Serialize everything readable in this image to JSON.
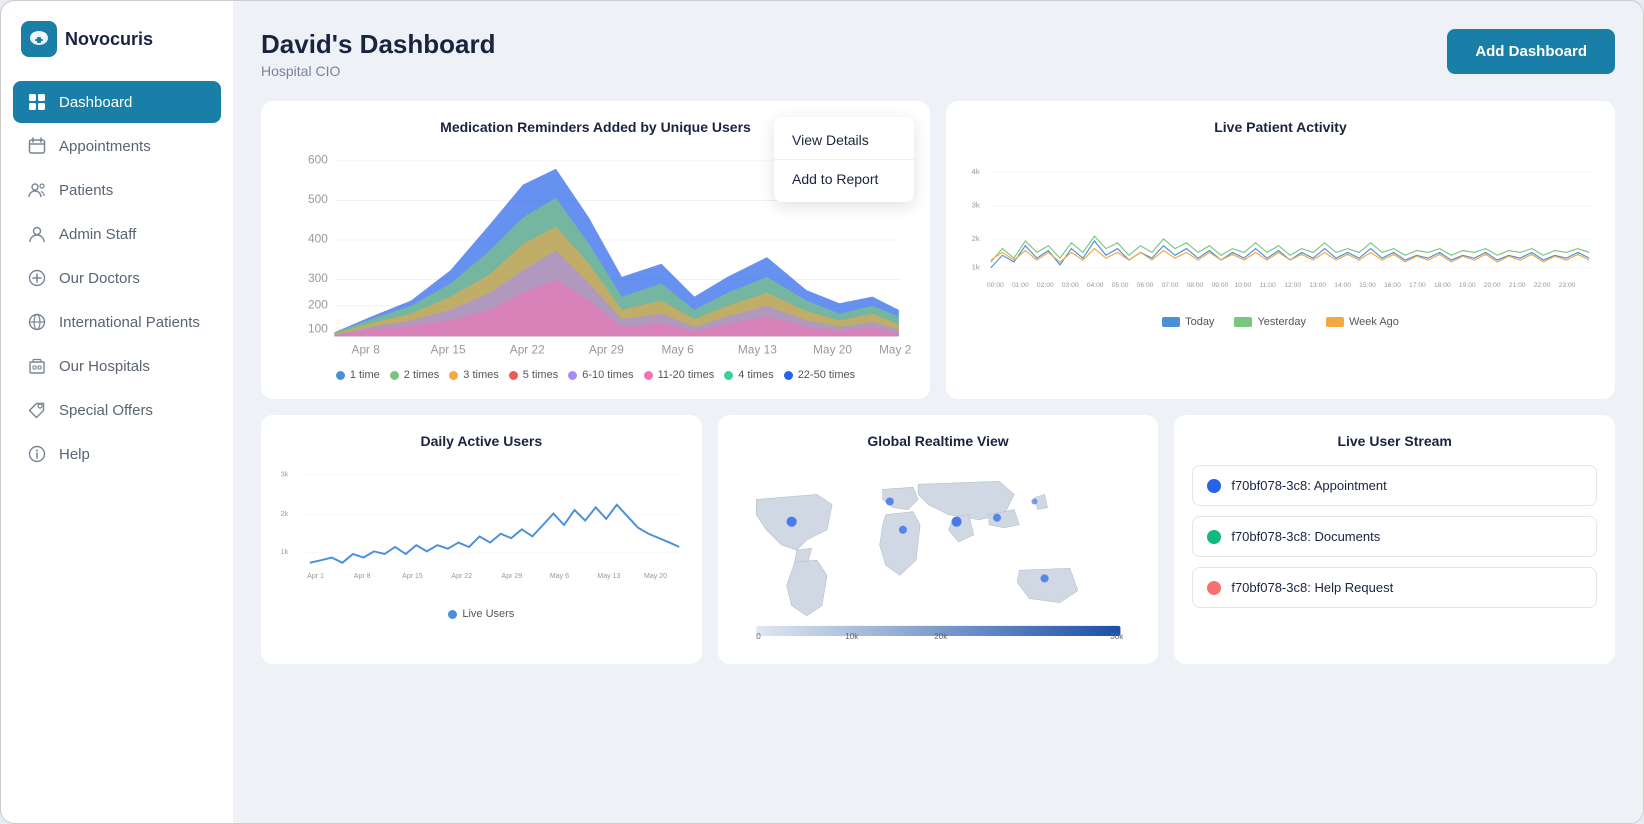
{
  "app": {
    "logo_text": "Novocuris"
  },
  "sidebar": {
    "items": [
      {
        "label": "Dashboard",
        "icon": "grid-icon",
        "active": true
      },
      {
        "label": "Appointments",
        "icon": "calendar-icon",
        "active": false
      },
      {
        "label": "Patients",
        "icon": "users-icon",
        "active": false
      },
      {
        "label": "Admin Staff",
        "icon": "person-icon",
        "active": false
      },
      {
        "label": "Our Doctors",
        "icon": "plus-circle-icon",
        "active": false
      },
      {
        "label": "International Patients",
        "icon": "globe-icon",
        "active": false
      },
      {
        "label": "Our Hospitals",
        "icon": "building-icon",
        "active": false
      },
      {
        "label": "Special Offers",
        "icon": "tag-icon",
        "active": false
      },
      {
        "label": "Help",
        "icon": "info-icon",
        "active": false
      }
    ]
  },
  "header": {
    "title": "David's Dashboard",
    "subtitle": "Hospital CIO",
    "add_button": "Add Dashboard"
  },
  "charts": {
    "medication_reminders": {
      "title": "Medication Reminders Added by Unique Users",
      "legend": [
        {
          "label": "1 time",
          "color": "#4a90d9"
        },
        {
          "label": "2 times",
          "color": "#7bc67e"
        },
        {
          "label": "3 times",
          "color": "#f4a742"
        },
        {
          "label": "5 times",
          "color": "#e95c5c"
        },
        {
          "label": "6-10 times",
          "color": "#a78bfa"
        },
        {
          "label": "11-20 times",
          "color": "#f472b6"
        },
        {
          "label": "4 times",
          "color": "#34d399"
        },
        {
          "label": "22-50 times",
          "color": "#2563eb"
        }
      ]
    },
    "live_patient": {
      "title": "Live Patient Activity",
      "legend": [
        {
          "label": "Today",
          "color": "#4a90d9"
        },
        {
          "label": "Yesterday",
          "color": "#7bc67e"
        },
        {
          "label": "Week Ago",
          "color": "#f4a742"
        }
      ]
    },
    "daily_active": {
      "title": "Daily Active Users",
      "legend": [
        {
          "label": "Live Users",
          "color": "#4a90d9"
        }
      ]
    },
    "global_realtime": {
      "title": "Global Realtime View",
      "gradient_min": "0",
      "gradient_mid": "10k",
      "gradient_max1": "20k",
      "gradient_max2": "30k"
    },
    "live_stream": {
      "title": "Live User Stream",
      "items": [
        {
          "id": "f70bf078-3c8: Appointment",
          "color": "#2563eb"
        },
        {
          "id": "f70bf078-3c8: Documents",
          "color": "#10b981"
        },
        {
          "id": "f70bf078-3c8: Help Request",
          "color": "#f87171"
        }
      ]
    }
  },
  "dropdown": {
    "view_details": "View Details",
    "add_to_report": "Add to Report"
  }
}
